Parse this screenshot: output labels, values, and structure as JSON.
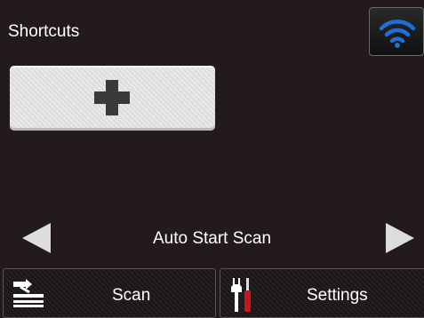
{
  "header": {
    "title": "Shortcuts",
    "wifi_icon": "wifi-icon",
    "wifi_color": "#1f6fd6"
  },
  "shortcuts": {
    "add_icon": "plus-icon"
  },
  "navigator": {
    "label": "Auto Start Scan",
    "prev_icon": "triangle-left-icon",
    "next_icon": "triangle-right-icon"
  },
  "bottom_bar": {
    "scan_label": "Scan",
    "scan_icon": "scanner-icon",
    "settings_label": "Settings",
    "settings_icon": "tools-icon",
    "settings_accent": "#c8161d"
  }
}
